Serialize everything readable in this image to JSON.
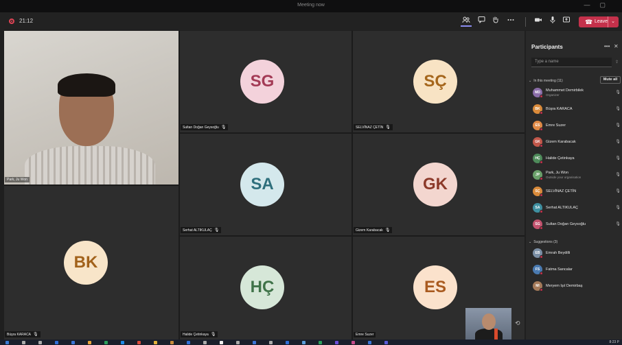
{
  "window": {
    "title": "Meeting now",
    "minimize": "—",
    "maximize": "▢"
  },
  "toolbar": {
    "timer": "21:12",
    "icons": [
      "people-icon",
      "chat-icon",
      "raise-hand-icon",
      "more-icon",
      "camera-icon",
      "mic-icon",
      "share-icon"
    ],
    "leave_label": "Leave"
  },
  "tiles": [
    {
      "name": "Park, Ju Won",
      "video": true
    },
    {
      "name": "Sultan Doğan Geysoğlu",
      "initials": "SG",
      "bg": "#f3d2db",
      "fg": "#a33a55"
    },
    {
      "name": "SELVİNAZ ÇETİN",
      "initials": "SÇ",
      "bg": "#f8e3c4",
      "fg": "#a5661c"
    },
    {
      "name": "Serhat ALTIKULAÇ",
      "initials": "SA",
      "bg": "#d4e8ec",
      "fg": "#2e6f7c"
    },
    {
      "name": "Gizem Karabacak",
      "initials": "GK",
      "bg": "#f3d6cf",
      "fg": "#8c3a2a"
    },
    {
      "name": "Büşra KARACA",
      "initials": "BK",
      "bg": "#f8e5c9",
      "fg": "#a2621b"
    },
    {
      "name": "Halide Çetinkaya",
      "initials": "HÇ",
      "bg": "#d6e7d8",
      "fg": "#3f7348"
    },
    {
      "name": "Emre Suzer",
      "initials": "ES",
      "bg": "#fbe2cc",
      "fg": "#a95a1f"
    }
  ],
  "panel": {
    "title": "Participants",
    "search_placeholder": "Type a name",
    "in_meeting_label": "In this meeting (11)",
    "mute_all_label": "Mute all",
    "suggestions_label": "Suggestions (3)",
    "participants": [
      {
        "name": "Muhammet Demirbilek",
        "sub": "Organizer",
        "initials": "MD",
        "color": "#8a6da8",
        "photo": true
      },
      {
        "name": "Büşra KARACA",
        "initials": "BK",
        "color": "#d98a3a"
      },
      {
        "name": "Emre Suzer",
        "initials": "ES",
        "color": "#e08a46"
      },
      {
        "name": "Gizem Karabacak",
        "initials": "GK",
        "color": "#c2574a"
      },
      {
        "name": "Halide Çetinkaya",
        "initials": "HÇ",
        "color": "#4e8a5a"
      },
      {
        "name": "Park, Ju Won",
        "sub": "Outside your organisation",
        "initials": "JP",
        "color": "#6aa06a"
      },
      {
        "name": "SELVİNAZ ÇETİN",
        "initials": "SÇ",
        "color": "#d98a3a"
      },
      {
        "name": "Serhat ALTIKULAÇ",
        "initials": "SA",
        "color": "#3f8fa0"
      },
      {
        "name": "Sultan Doğan Geysoğlu",
        "initials": "SG",
        "color": "#c2526e"
      }
    ],
    "suggestions": [
      {
        "name": "Emrah Beydilli",
        "initials": "EB",
        "color": "#7b8fa5",
        "photo": true
      },
      {
        "name": "Fatma Sancalar",
        "initials": "FS",
        "color": "#4a7ab0"
      },
      {
        "name": "Meryem Işıl Demirbaş",
        "initials": "MI",
        "color": "#a57b5a",
        "photo": true
      }
    ]
  },
  "taskbar": {
    "clock": "8:23 P"
  }
}
